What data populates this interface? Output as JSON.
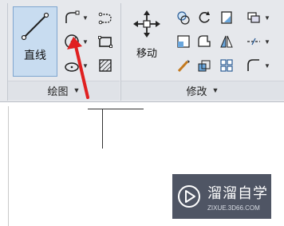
{
  "ribbon": {
    "draw_panel": {
      "title": "绘图",
      "line_button": "直线"
    },
    "modify_panel": {
      "title": "修改",
      "move_button": "移动"
    }
  },
  "icons": {
    "draw": [
      "polyline-icon",
      "circle-icon",
      "arc-icon",
      "ellipse-icon",
      "rectangle-icon",
      "hatch-icon"
    ],
    "modify": [
      "rotate-icon",
      "trim-icon",
      "copy-icon",
      "mirror-icon",
      "fillet-icon",
      "array-icon",
      "stretch-icon",
      "scale-icon",
      "explode-icon"
    ]
  },
  "watermark": {
    "name": "溜溜自学",
    "url": "ZIXUE.3D66.COM"
  },
  "colors": {
    "accent": "#c8dcf0",
    "arrow": "#e02020",
    "ribbon_bg": "#e6e8ec"
  }
}
